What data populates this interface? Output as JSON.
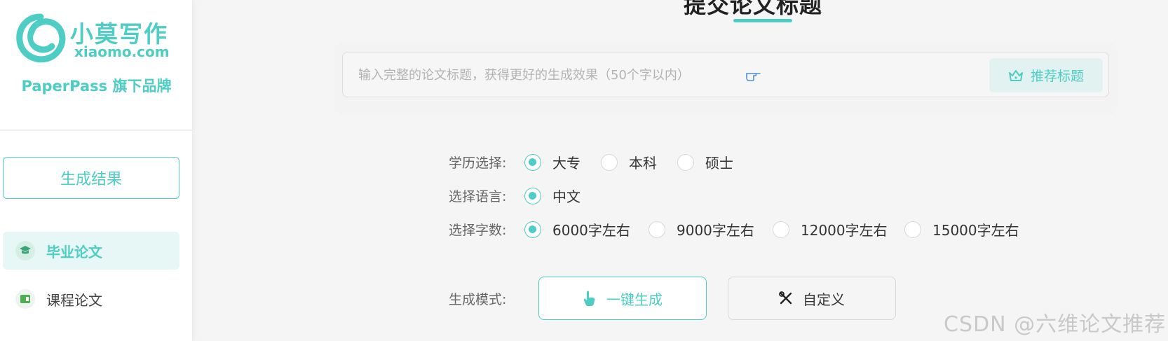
{
  "brand": {
    "name": "小莫写作",
    "domain": "xiaomo.com",
    "tagline": "PaperPass 旗下品牌",
    "accent_color": "#4ecdc4"
  },
  "sidebar": {
    "result_button": "生成结果",
    "items": [
      {
        "label": "毕业论文",
        "icon": "graduation-cap-icon",
        "active": true
      },
      {
        "label": "课程论文",
        "icon": "book-icon",
        "active": false
      }
    ]
  },
  "main": {
    "title": "提交论文标题",
    "title_input": {
      "placeholder": "输入完整的论文标题，获得更好的生成效果（50个字以内）",
      "value": ""
    },
    "recommend_button": "推荐标题",
    "education": {
      "label": "学历选择:",
      "options": [
        "大专",
        "本科",
        "硕士"
      ],
      "selected": "大专"
    },
    "language": {
      "label": "选择语言:",
      "options": [
        "中文"
      ],
      "selected": "中文"
    },
    "word_count": {
      "label": "选择字数:",
      "options": [
        "6000字左右",
        "9000字左右",
        "12000字左右",
        "15000字左右"
      ],
      "selected": "6000字左右"
    },
    "mode": {
      "label": "生成模式:",
      "one_click": "一键生成",
      "custom": "自定义"
    }
  },
  "watermark": "CSDN @六维论文推荐"
}
